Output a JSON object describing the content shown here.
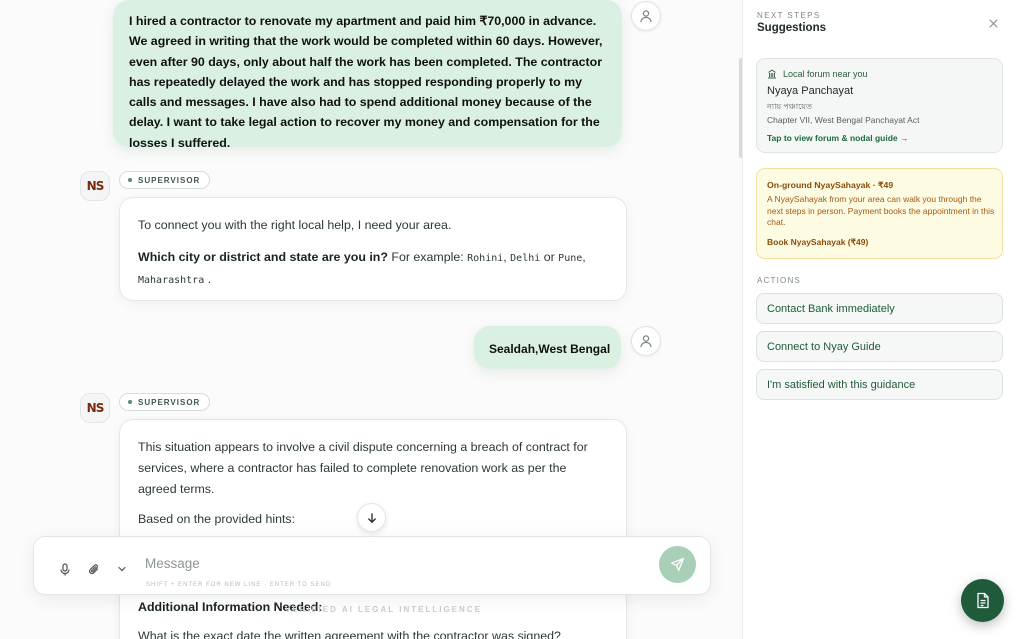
{
  "chat": {
    "user_msg_1": "I hired a contractor to renovate my apartment and paid him ₹70,000 in advance. We agreed in writing that the work would be completed within 60 days. However, even after 90 days, only about half the work has been completed. The contractor has repeatedly delayed the work and has stopped responding properly to my calls and messages. I have also had to spend additional money because of the delay. I want to take legal action to recover my money and compensation for the losses I suffered.",
    "bot_badge": "SUPERVISOR",
    "bot_avatar_text": "NS",
    "bot_msg_1": {
      "line1": "To connect you with the right local help, I need your area.",
      "question": "Which city or district and state are you in?",
      "example_prefix": " For example: ",
      "ex1": "Rohini",
      "sep1": ", ",
      "ex2": "Delhi",
      "or": " or ",
      "ex3": "Pune",
      "sep2": ",",
      "ex4": "Maharashtra",
      "end": "."
    },
    "user_msg_2": "Sealdah,West Bengal",
    "bot_msg_2": {
      "para1": "This situation appears to involve a civil dispute concerning a breach of contract for services, where a contractor has failed to complete renovation work as per the agreed terms.",
      "para2": "Based on the provided hints:",
      "heading": "Additional Information Needed:",
      "question": "What is the exact date the written agreement with the contractor was signed?"
    }
  },
  "composer": {
    "placeholder": "Message",
    "hint": "SHIFT + ENTER FOR NEW LINE · ENTER TO SEND"
  },
  "footer_brand": "VERIFIED AI LEGAL INTELLIGENCE",
  "sidebar": {
    "overline": "NEXT STEPS",
    "title": "Suggestions",
    "forum_card": {
      "label": "Local forum near you",
      "name": "Nyaya Panchayat",
      "name_local": "ন্যায় পঞ্চায়েত",
      "act": "Chapter VII, West Bengal Panchayat Act",
      "link": "Tap to view forum & nodal guide →"
    },
    "sahayak_card": {
      "title": "On-ground NyaySahayak · ₹49",
      "desc": "A NyaySahayak from your area can walk you through the next steps in person. Payment books the appointment in this chat.",
      "cta": "Book NyaySahayak (₹49)"
    },
    "actions_label": "ACTIONS",
    "actions": [
      "Contact Bank immediately",
      "Connect to Nyay Guide",
      "I'm satisfied with this guidance"
    ]
  },
  "colors": {
    "accent": "#1f5b3a",
    "user_bubble": "#d9f0e2",
    "sahayak_bg": "#fefbe3"
  },
  "icons": {
    "user_avatar": "user-icon",
    "mic": "mic-icon",
    "attach": "paperclip-icon",
    "expand": "chevron-down-icon",
    "send": "send-icon",
    "scroll": "arrow-down-icon",
    "close": "close-icon",
    "forum": "building-icon",
    "fab": "document-icon"
  }
}
